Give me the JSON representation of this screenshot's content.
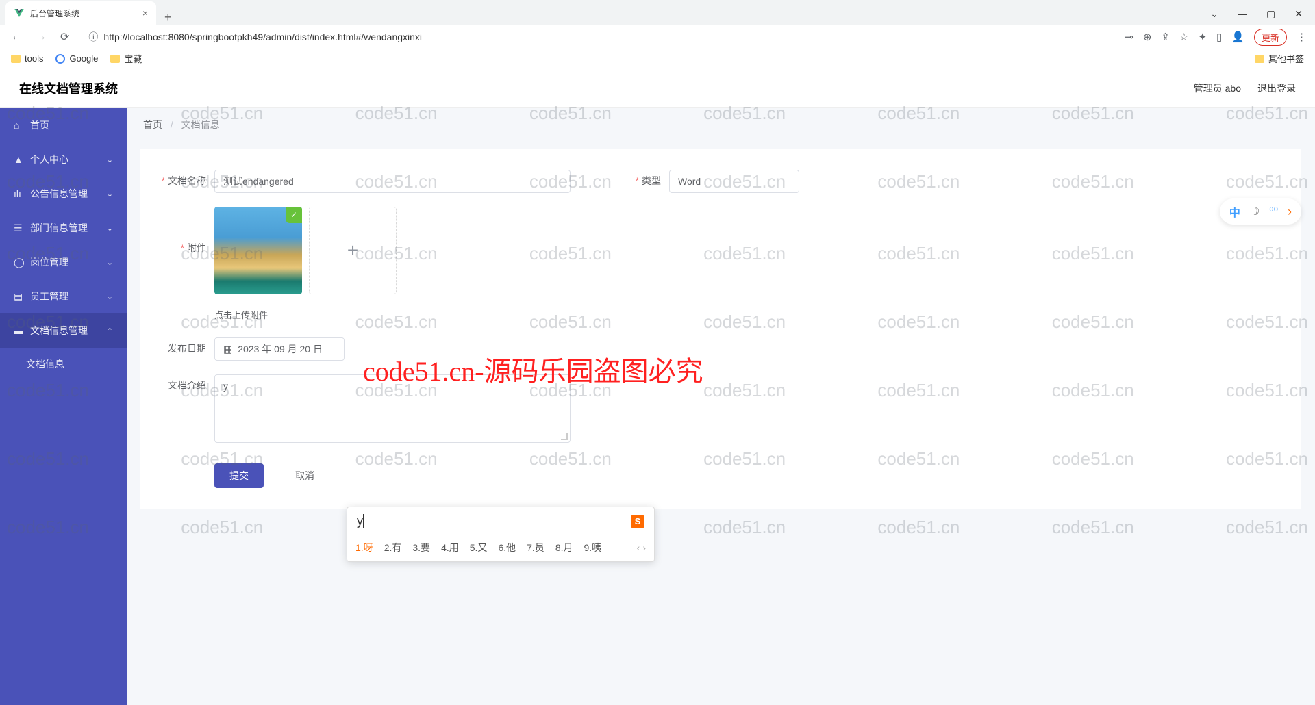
{
  "browser": {
    "tab_title": "后台管理系统",
    "url": "http://localhost:8080/springbootpkh49/admin/dist/index.html#/wendangxinxi",
    "update_btn": "更新",
    "bookmarks": {
      "tools": "tools",
      "google": "Google",
      "treasure": "宝藏",
      "other": "其他书签"
    }
  },
  "header": {
    "app_title": "在线文档管理系统",
    "user_label": "管理员 abo",
    "logout": "退出登录"
  },
  "sidebar": {
    "home": "首页",
    "personal": "个人中心",
    "notice": "公告信息管理",
    "dept": "部门信息管理",
    "job": "岗位管理",
    "staff": "员工管理",
    "doc_mgr": "文档信息管理",
    "doc_info": "文档信息"
  },
  "breadcrumb": {
    "home": "首页",
    "current": "文档信息"
  },
  "form": {
    "name_label": "文档名称",
    "name_value": "测试endangered",
    "type_label": "类型",
    "type_value": "Word",
    "attach_label": "附件",
    "upload_tip": "点击上传附件",
    "date_label": "发布日期",
    "date_value": "2023 年 09 月 20 日",
    "intro_label": "文档介绍",
    "intro_value": "y",
    "submit": "提交",
    "cancel": "取消"
  },
  "ime": {
    "input": "y",
    "candidates": [
      "1.呀",
      "2.有",
      "3.要",
      "4.用",
      "5.又",
      "6.他",
      "7.员",
      "8.月",
      "9.咦"
    ]
  },
  "float": {
    "ch": "中"
  },
  "watermark": {
    "text": "code51.cn",
    "big": "code51.cn-源码乐园盗图必究"
  }
}
